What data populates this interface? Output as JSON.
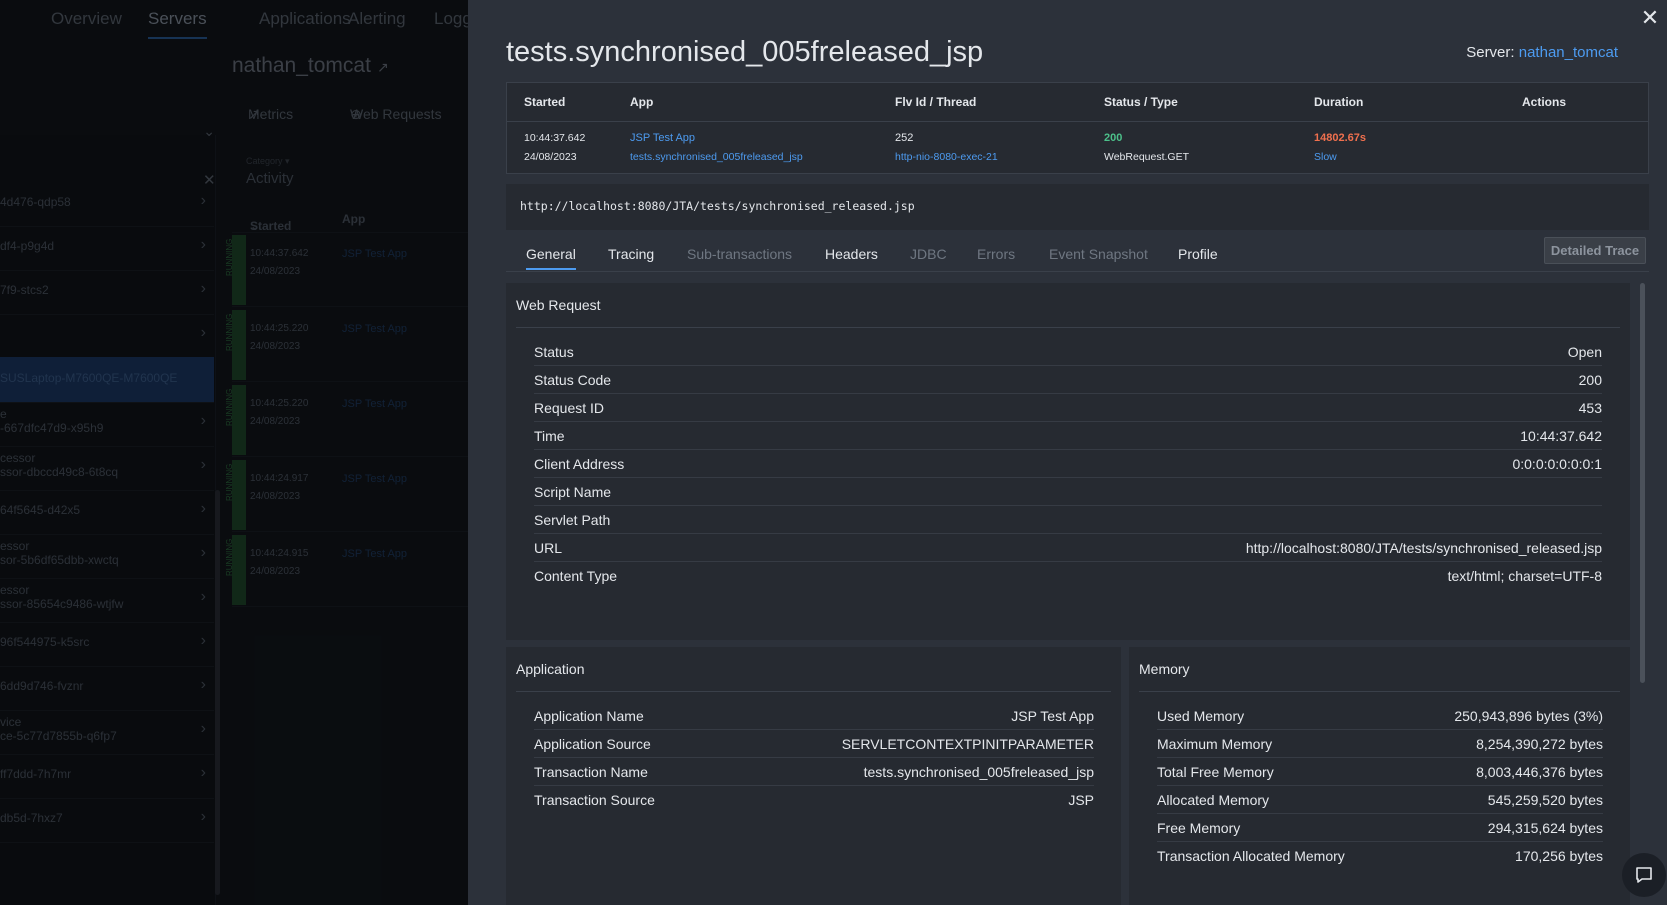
{
  "background": {
    "nav": [
      "Overview",
      "Servers",
      "Applications",
      "Alerting",
      "Logg"
    ],
    "server_title": "nathan_tomcat",
    "subtabs": [
      "Metrics",
      "Web Requests"
    ],
    "category_label": "Category ▾",
    "activity_title": "Activity",
    "activity_header": {
      "started": "Started",
      "app": "App"
    },
    "running_label": "RUNNING",
    "activity_rows": [
      {
        "time": "10:44:37.642",
        "date": "24/08/2023",
        "app": "JSP Test App"
      },
      {
        "time": "10:44:25.220",
        "date": "24/08/2023",
        "app": "JSP Test App"
      },
      {
        "time": "10:44:25.220",
        "date": "24/08/2023",
        "app": "JSP Test App"
      },
      {
        "time": "10:44:24.917",
        "date": "24/08/2023",
        "app": "JSP Test App"
      },
      {
        "time": "10:44:24.915",
        "date": "24/08/2023",
        "app": "JSP Test App"
      }
    ],
    "left_items": [
      {
        "l1": "",
        "l2": "4d476-qdp58"
      },
      {
        "l1": "",
        "l2": "df4-p9g4d"
      },
      {
        "l1": "",
        "l2": "7f9-stcs2"
      },
      {
        "l1": "",
        "l2": ""
      },
      {
        "l1": "",
        "l2": "SUSLaptop-M7600QE-M7600QE"
      },
      {
        "l1": "e",
        "l2": "-667dfc47d9-x95h9"
      },
      {
        "l1": "cessor",
        "l2": "ssor-dbccd49c8-6t8cq"
      },
      {
        "l1": "",
        "l2": "64f5645-d42x5"
      },
      {
        "l1": "essor",
        "l2": "sor-5b6df65dbb-xwctq"
      },
      {
        "l1": "essor",
        "l2": "ssor-85654c9486-wtjfw"
      },
      {
        "l1": "",
        "l2": "96f544975-k5src"
      },
      {
        "l1": "",
        "l2": "6dd9d746-fvznr"
      },
      {
        "l1": "vice",
        "l2": "ce-5c77d7855b-q6fp7"
      },
      {
        "l1": "",
        "l2": "ff7ddd-7h7mr"
      },
      {
        "l1": "",
        "l2": "db5d-7hxz7"
      }
    ]
  },
  "drawer": {
    "title": "tests.synchronised_005freleased_jsp",
    "server_label": "Server:",
    "server_name": "nathan_tomcat",
    "summary": {
      "headers": {
        "started": "Started",
        "app": "App",
        "thread": "Flv Id / Thread",
        "status": "Status / Type",
        "duration": "Duration",
        "actions": "Actions"
      },
      "started_time": "10:44:37.642",
      "started_date": "24/08/2023",
      "app_name": "JSP Test App",
      "app_transaction": "tests.synchronised_005freleased_jsp",
      "flv_id": "252",
      "thread": "http-nio-8080-exec-21",
      "status_code": "200",
      "type": "WebRequest.GET",
      "duration": "14802.67s",
      "duration_tag": "Slow"
    },
    "url": "http://localhost:8080/JTA/tests/synchronised_released.jsp",
    "tabs": [
      {
        "label": "General",
        "enabled": true
      },
      {
        "label": "Tracing",
        "enabled": true
      },
      {
        "label": "Sub-transactions",
        "enabled": false
      },
      {
        "label": "Headers",
        "enabled": true
      },
      {
        "label": "JDBC",
        "enabled": false
      },
      {
        "label": "Errors",
        "enabled": false
      },
      {
        "label": "Event Snapshot",
        "enabled": false
      },
      {
        "label": "Profile",
        "enabled": true
      }
    ],
    "detailed_trace_label": "Detailed Trace",
    "web_request": {
      "title": "Web Request",
      "rows": [
        {
          "k": "Status",
          "v": "Open"
        },
        {
          "k": "Status Code",
          "v": "200"
        },
        {
          "k": "Request ID",
          "v": "453"
        },
        {
          "k": "Time",
          "v": "10:44:37.642"
        },
        {
          "k": "Client Address",
          "v": "0:0:0:0:0:0:0:1"
        },
        {
          "k": "Script Name",
          "v": ""
        },
        {
          "k": "Servlet Path",
          "v": ""
        },
        {
          "k": "URL",
          "v": "http://localhost:8080/JTA/tests/synchronised_released.jsp"
        },
        {
          "k": "Content Type",
          "v": "text/html; charset=UTF-8"
        }
      ]
    },
    "application": {
      "title": "Application",
      "rows": [
        {
          "k": "Application Name",
          "v": "JSP Test App"
        },
        {
          "k": "Application Source",
          "v": "SERVLETCONTEXTPINITPARAMETER"
        },
        {
          "k": "Transaction Name",
          "v": "tests.synchronised_005freleased_jsp"
        },
        {
          "k": "Transaction Source",
          "v": "JSP"
        }
      ]
    },
    "memory": {
      "title": "Memory",
      "rows": [
        {
          "k": "Used Memory",
          "v": "250,943,896 bytes (3%)"
        },
        {
          "k": "Maximum Memory",
          "v": "8,254,390,272 bytes"
        },
        {
          "k": "Total Free Memory",
          "v": "8,003,446,376 bytes"
        },
        {
          "k": "Allocated Memory",
          "v": "545,259,520 bytes"
        },
        {
          "k": "Free Memory",
          "v": "294,315,624 bytes"
        },
        {
          "k": "Transaction Allocated Memory",
          "v": "170,256 bytes"
        }
      ]
    }
  },
  "colors": {
    "link": "#4d9bf0",
    "status_ok": "#4cc08a",
    "duration_slow": "#f0704e",
    "running": "#1f4a2c",
    "selected": "#1c3a66"
  },
  "icons": [
    "close-icon",
    "external-link-icon",
    "metrics-icon",
    "globe-icon",
    "chevron-right-icon",
    "chat-icon"
  ]
}
